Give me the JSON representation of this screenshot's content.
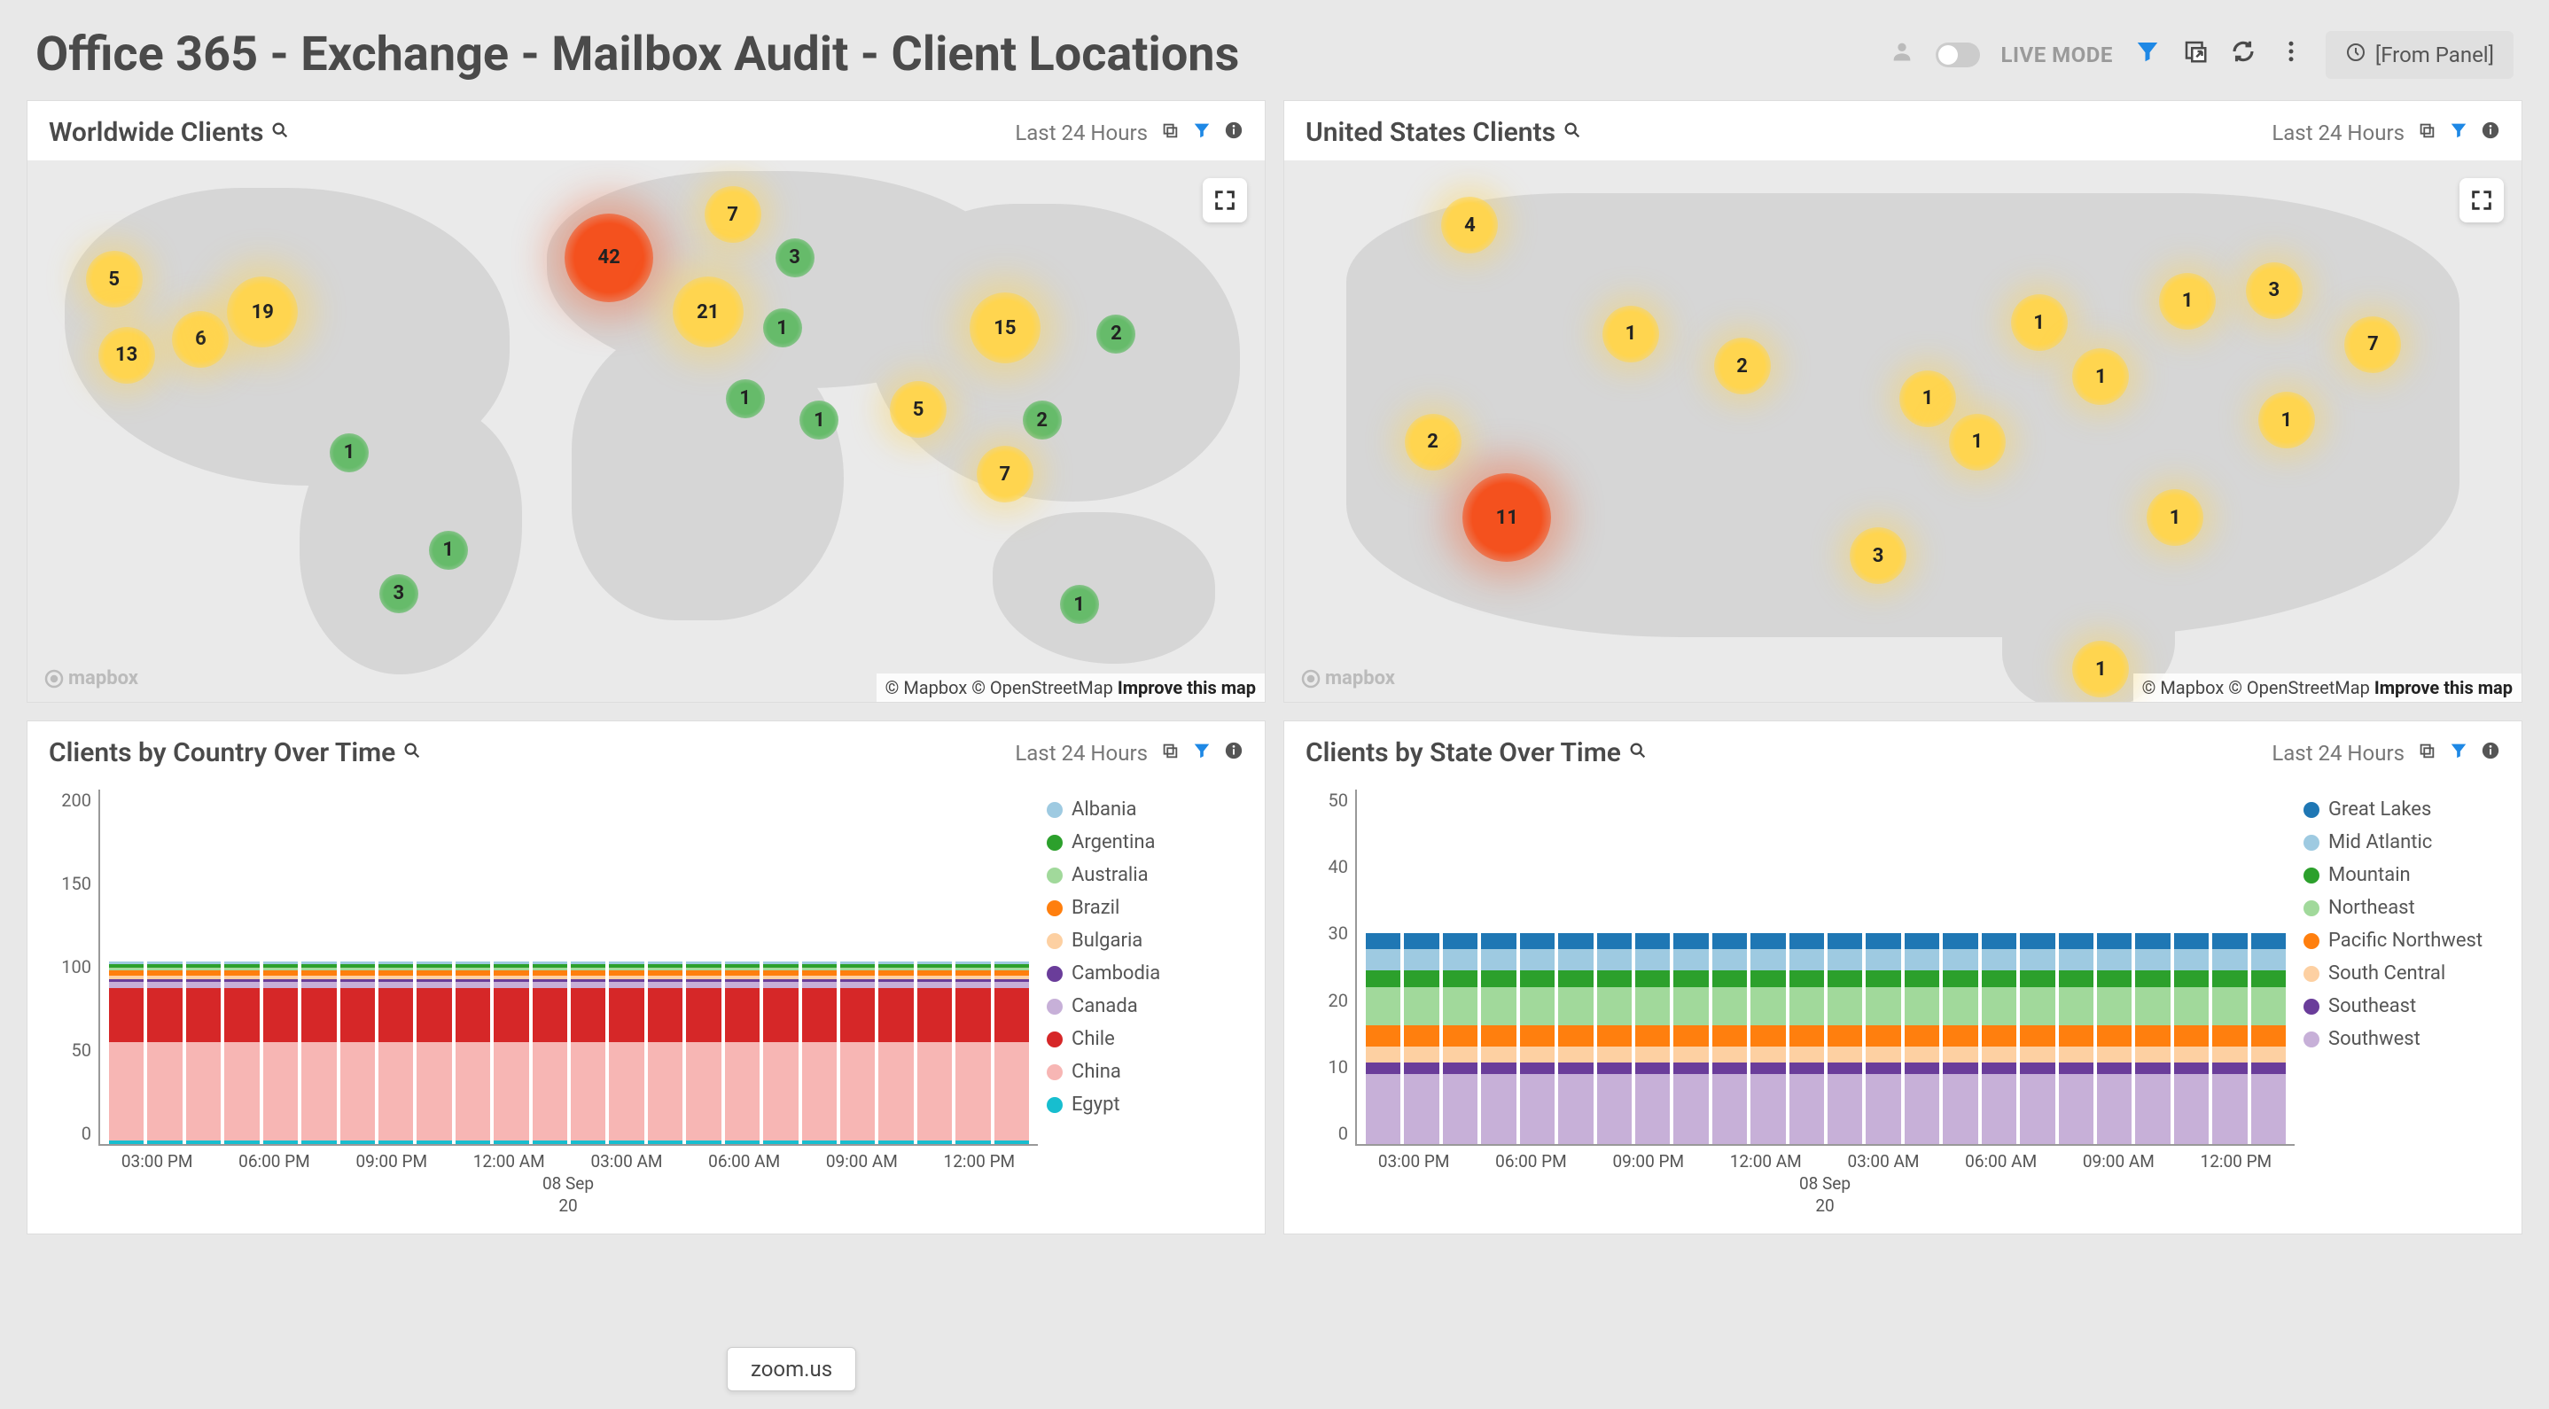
{
  "header": {
    "title": "Office 365 - Exchange - Mailbox Audit - Client Locations",
    "live_mode_label": "LIVE MODE",
    "from_panel_label": "[From Panel]"
  },
  "panels": {
    "world_map": {
      "title": "Worldwide Clients",
      "time_label": "Last 24 Hours",
      "attrib_mapbox": "© Mapbox",
      "attrib_osm": "© OpenStreetMap",
      "attrib_improve": "Improve this map",
      "logo": "mapbox",
      "bubbles": [
        {
          "v": 5,
          "c": "yellow",
          "x": 7,
          "y": 22
        },
        {
          "v": 13,
          "c": "yellow",
          "x": 8,
          "y": 36
        },
        {
          "v": 6,
          "c": "yellow",
          "x": 14,
          "y": 33
        },
        {
          "v": 19,
          "c": "big-yellow",
          "x": 19,
          "y": 28
        },
        {
          "v": 1,
          "c": "green",
          "x": 26,
          "y": 54
        },
        {
          "v": 3,
          "c": "green",
          "x": 30,
          "y": 80
        },
        {
          "v": 1,
          "c": "green",
          "x": 34,
          "y": 72
        },
        {
          "v": 42,
          "c": "orange",
          "x": 47,
          "y": 18
        },
        {
          "v": 7,
          "c": "yellow",
          "x": 57,
          "y": 10
        },
        {
          "v": 3,
          "c": "green",
          "x": 62,
          "y": 18
        },
        {
          "v": 21,
          "c": "big-yellow",
          "x": 55,
          "y": 28
        },
        {
          "v": 1,
          "c": "green",
          "x": 61,
          "y": 31
        },
        {
          "v": 1,
          "c": "green",
          "x": 58,
          "y": 44
        },
        {
          "v": 1,
          "c": "green",
          "x": 64,
          "y": 48
        },
        {
          "v": 5,
          "c": "yellow",
          "x": 72,
          "y": 46
        },
        {
          "v": 15,
          "c": "big-yellow",
          "x": 79,
          "y": 31
        },
        {
          "v": 2,
          "c": "green",
          "x": 88,
          "y": 32
        },
        {
          "v": 2,
          "c": "green",
          "x": 82,
          "y": 48
        },
        {
          "v": 7,
          "c": "yellow",
          "x": 79,
          "y": 58
        },
        {
          "v": 1,
          "c": "green",
          "x": 85,
          "y": 82
        }
      ]
    },
    "us_map": {
      "title": "United States Clients",
      "time_label": "Last 24 Hours",
      "attrib_mapbox": "© Mapbox",
      "attrib_osm": "© OpenStreetMap",
      "attrib_improve": "Improve this map",
      "logo": "mapbox",
      "bubbles": [
        {
          "v": 4,
          "c": "yellow",
          "x": 15,
          "y": 12
        },
        {
          "v": 1,
          "c": "yellow",
          "x": 28,
          "y": 32
        },
        {
          "v": 2,
          "c": "yellow",
          "x": 37,
          "y": 38
        },
        {
          "v": 2,
          "c": "yellow",
          "x": 12,
          "y": 52
        },
        {
          "v": 11,
          "c": "orange",
          "x": 18,
          "y": 66
        },
        {
          "v": 3,
          "c": "yellow",
          "x": 48,
          "y": 73
        },
        {
          "v": 1,
          "c": "yellow",
          "x": 52,
          "y": 44
        },
        {
          "v": 1,
          "c": "yellow",
          "x": 56,
          "y": 52
        },
        {
          "v": 1,
          "c": "yellow",
          "x": 61,
          "y": 30
        },
        {
          "v": 1,
          "c": "yellow",
          "x": 66,
          "y": 40
        },
        {
          "v": 1,
          "c": "yellow",
          "x": 73,
          "y": 26
        },
        {
          "v": 3,
          "c": "yellow",
          "x": 80,
          "y": 24
        },
        {
          "v": 7,
          "c": "yellow",
          "x": 88,
          "y": 34
        },
        {
          "v": 1,
          "c": "yellow",
          "x": 81,
          "y": 48
        },
        {
          "v": 1,
          "c": "yellow",
          "x": 72,
          "y": 66
        },
        {
          "v": 1,
          "c": "yellow",
          "x": 66,
          "y": 94
        }
      ]
    },
    "country_chart": {
      "title": "Clients by Country Over Time",
      "time_label": "Last 24 Hours"
    },
    "state_chart": {
      "title": "Clients by State Over Time",
      "time_label": "Last 24 Hours"
    }
  },
  "chart_data": [
    {
      "type": "bar",
      "panel": "country_chart",
      "ylim": [
        0,
        200
      ],
      "yticks": [
        200,
        150,
        100,
        50,
        0
      ],
      "xticks": [
        "03:00 PM",
        "06:00 PM",
        "09:00 PM",
        "12:00 AM",
        "03:00 AM",
        "06:00 AM",
        "09:00 AM",
        "12:00 PM"
      ],
      "x_sub_label": "08 Sep",
      "x_sub_label2": "20",
      "bar_count": 24,
      "series": [
        {
          "name": "Albania",
          "color": "#9ecae1",
          "value": 2
        },
        {
          "name": "Argentina",
          "color": "#2ca02c",
          "value": 3
        },
        {
          "name": "Australia",
          "color": "#a1d99b",
          "value": 2
        },
        {
          "name": "Brazil",
          "color": "#ff7f0e",
          "value": 4
        },
        {
          "name": "Bulgaria",
          "color": "#fdd0a2",
          "value": 3
        },
        {
          "name": "Cambodia",
          "color": "#6a3d9a",
          "value": 2
        },
        {
          "name": "Canada",
          "color": "#c7b0d8",
          "value": 5
        },
        {
          "name": "Chile",
          "color": "#d62728",
          "value": 43
        },
        {
          "name": "China",
          "color": "#f7b6b4",
          "value": 78
        },
        {
          "name": "Egypt",
          "color": "#17becf",
          "value": 3
        }
      ],
      "__note_values_repeat": "each bar renders identical stack ~145 tall"
    },
    {
      "type": "bar",
      "panel": "state_chart",
      "ylim": [
        0,
        50
      ],
      "yticks": [
        50,
        40,
        30,
        20,
        10,
        0
      ],
      "xticks": [
        "03:00 PM",
        "06:00 PM",
        "09:00 PM",
        "12:00 AM",
        "03:00 AM",
        "06:00 AM",
        "09:00 AM",
        "12:00 PM"
      ],
      "x_sub_label": "08 Sep",
      "x_sub_label2": "20",
      "bar_count": 24,
      "series": [
        {
          "name": "Great Lakes",
          "color": "#1f77b4",
          "value": 3
        },
        {
          "name": "Mid Atlantic",
          "color": "#9ecae1",
          "value": 4
        },
        {
          "name": "Mountain",
          "color": "#2ca02c",
          "value": 3
        },
        {
          "name": "Northeast",
          "color": "#a1d99b",
          "value": 7
        },
        {
          "name": "Pacific Northwest",
          "color": "#ff7f0e",
          "value": 4
        },
        {
          "name": "South Central",
          "color": "#fdd0a2",
          "value": 3
        },
        {
          "name": "Southeast",
          "color": "#6a3d9a",
          "value": 2
        },
        {
          "name": "Southwest",
          "color": "#c7b0d8",
          "value": 13
        }
      ]
    }
  ],
  "tooltip": {
    "text": "zoom.us"
  }
}
